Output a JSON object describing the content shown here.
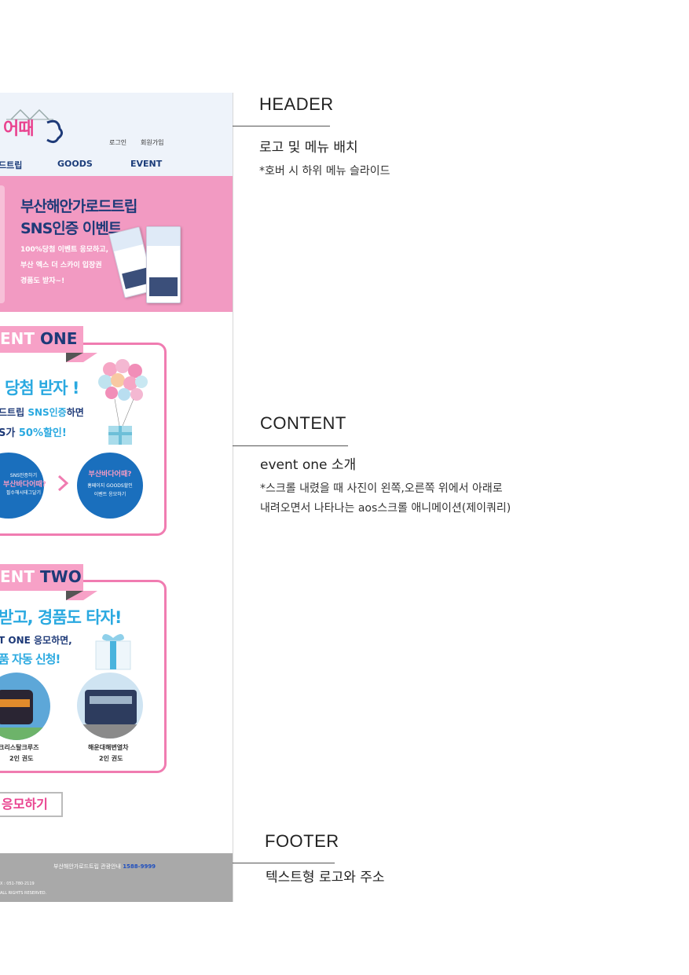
{
  "header": {
    "logo_text": "어때",
    "util_links": [
      "로그인",
      "회원가입"
    ],
    "nav_items": [
      "드트립",
      "GOODS",
      "EVENT"
    ]
  },
  "banner": {
    "title_line1": "부산해안가로드트립",
    "title_line2": "SNS인증 이벤트",
    "desc_line1": "100%당첨 이벤트 응모하고,",
    "desc_line2": "부산 엑스 더 스카이 입장권",
    "desc_line3": "경품도 받자~!"
  },
  "event_one": {
    "ribbon_prefix": "ENT",
    "ribbon_suffix": "ONE",
    "headline": "당첨 받자 !",
    "line1_pre": "드트립 ",
    "line1_hl": "SNS인증",
    "line1_post": "하면",
    "line2_pre": "S가 ",
    "line2_hl": "50%할인!",
    "circle1": [
      "SNS인증하기",
      "부산바다어때?",
      "필수해시태그달기"
    ],
    "circle2": [
      "부산바다어때?",
      "홈페이지 GOODS할인",
      "이벤트 응모하기"
    ]
  },
  "event_two": {
    "ribbon_prefix": "ENT",
    "ribbon_suffix": "TWO",
    "headline": "받고, 경품도 타자!",
    "line1": "T ONE 응모하면,",
    "line2": "품 자동 신청!",
    "prize1_name": "크리스탈크루즈",
    "prize1_qty": "2인 권도",
    "prize2_name": "해운대해변열차",
    "prize2_qty": "2인 권도"
  },
  "apply_button": "응모하기",
  "footer": {
    "info_text": "부산해안가로드트립 관광안내",
    "info_tel": "1588-9999",
    "small1": "X : 051-780-2119",
    "small2": "ALL RIGHTS RESERVED."
  },
  "annotations": {
    "header_title": "HEADER",
    "header_sub": "로고 및 메뉴 배치",
    "header_note": "*호버 시 하위 메뉴 슬라이드",
    "content_title": "CONTENT",
    "content_sub": "event one 소개",
    "content_note1": "*스크롤 내렸을 때 사진이 왼쪽,오른쪽 위에서 아래로",
    "content_note2": "내려오면서 나타나는 aos스크롤 애니메이션(제이쿼리)",
    "footer_title": "FOOTER",
    "footer_sub": "텍스트형 로고와 주소"
  },
  "colors": {
    "pink": "#f07cb1",
    "banner_pink": "#f29ac2",
    "navy": "#1e3a78",
    "sky": "#2aa9e0",
    "circle_blue": "#1a6fbd",
    "footer_gray": "#a9a9a9"
  }
}
